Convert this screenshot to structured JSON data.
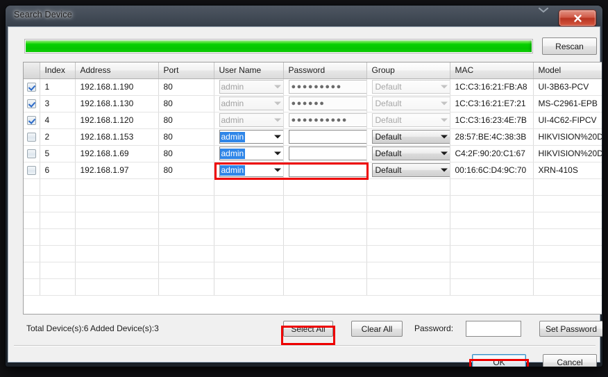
{
  "window": {
    "title": "Search Device",
    "close_label": "x"
  },
  "toolbar": {
    "rescan_label": "Rescan",
    "progress_percent": 100
  },
  "table": {
    "columns": [
      "",
      "Index",
      "Address",
      "Port",
      "User Name",
      "Password",
      "Group",
      "MAC",
      "Model"
    ],
    "rows": [
      {
        "checked": true,
        "index": "1",
        "address": "192.168.1.190",
        "port": "80",
        "username": "admin",
        "username_enabled": false,
        "password_dots": 9,
        "group": "Default",
        "group_enabled": false,
        "mac": "1C:C3:16:21:FB:A8",
        "model": "UI-3B63-PCV"
      },
      {
        "checked": true,
        "index": "3",
        "address": "192.168.1.130",
        "port": "80",
        "username": "admin",
        "username_enabled": false,
        "password_dots": 6,
        "group": "Default",
        "group_enabled": false,
        "mac": "1C:C3:16:21:E7:21",
        "model": "MS-C2961-EPB"
      },
      {
        "checked": true,
        "index": "4",
        "address": "192.168.1.120",
        "port": "80",
        "username": "admin",
        "username_enabled": false,
        "password_dots": 10,
        "group": "Default",
        "group_enabled": false,
        "mac": "1C:C3:16:23:4E:7B",
        "model": "UI-4C62-FIPCV"
      },
      {
        "checked": false,
        "index": "2",
        "address": "192.168.1.153",
        "port": "80",
        "username": "admin",
        "username_enabled": true,
        "password_dots": 0,
        "group": "Default",
        "group_enabled": true,
        "mac": "28:57:BE:4C:38:3B",
        "model": "HIKVISION%20D"
      },
      {
        "checked": false,
        "index": "5",
        "address": "192.168.1.69",
        "port": "80",
        "username": "admin",
        "username_enabled": true,
        "password_dots": 0,
        "group": "Default",
        "group_enabled": true,
        "mac": "C4:2F:90:20:C1:67",
        "model": "HIKVISION%20D"
      },
      {
        "checked": false,
        "index": "6",
        "address": "192.168.1.97",
        "port": "80",
        "username": "admin",
        "username_enabled": true,
        "password_dots": 0,
        "group": "Default",
        "group_enabled": true,
        "mac": "00:16:6C:D4:9C:70",
        "model": "XRN-410S"
      }
    ],
    "empty_row_count": 7
  },
  "footer": {
    "status": "Total Device(s):6  Added Device(s):3",
    "select_all_label": "Select All",
    "clear_all_label": "Clear All",
    "password_label": "Password:",
    "password_value": "",
    "set_password_label": "Set Password"
  },
  "dialog_buttons": {
    "ok_label": "OK",
    "cancel_label": "Cancel"
  },
  "colors": {
    "progress_green": "#07cf00",
    "highlight_red": "#ee0000",
    "selection_blue": "#2f86e8"
  }
}
